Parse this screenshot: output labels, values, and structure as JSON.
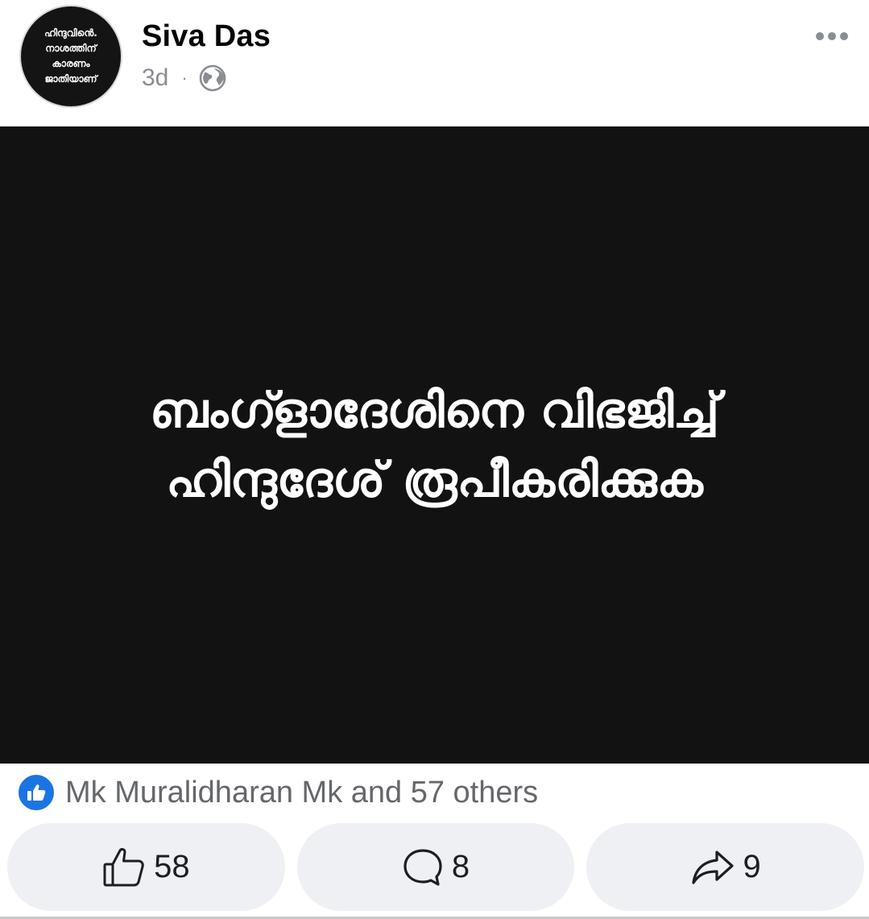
{
  "header": {
    "avatar_lines": [
      "ഹിന്ദുവിൻെ.",
      "നാശത്തിന്",
      "കാരണം",
      "ജാതിയാണ്"
    ],
    "author_name": "Siva Das",
    "time": "3d",
    "separator": "·",
    "privacy_icon": "globe-icon",
    "more_icon": "more-options-icon"
  },
  "post_image": {
    "lines": [
      "ബംഗ്ളാദേശിനെ വിഭജിച്ച്",
      "ഹിന്ദുദേശ് രൂപീകരിക്കുക"
    ],
    "background": "#121212",
    "text_color": "#ffffff"
  },
  "reactions": {
    "icon": "like-reaction-icon",
    "text": "Mk Muralidharan Mk and 57 others"
  },
  "actions": {
    "like": {
      "icon": "thumbs-up-icon",
      "count": "58"
    },
    "comment": {
      "icon": "comment-icon",
      "count": "8"
    },
    "share": {
      "icon": "share-icon",
      "count": "9"
    }
  },
  "colors": {
    "accent": "#1b74e4",
    "muted_text": "#65676b",
    "button_bg": "#eff0f4"
  }
}
